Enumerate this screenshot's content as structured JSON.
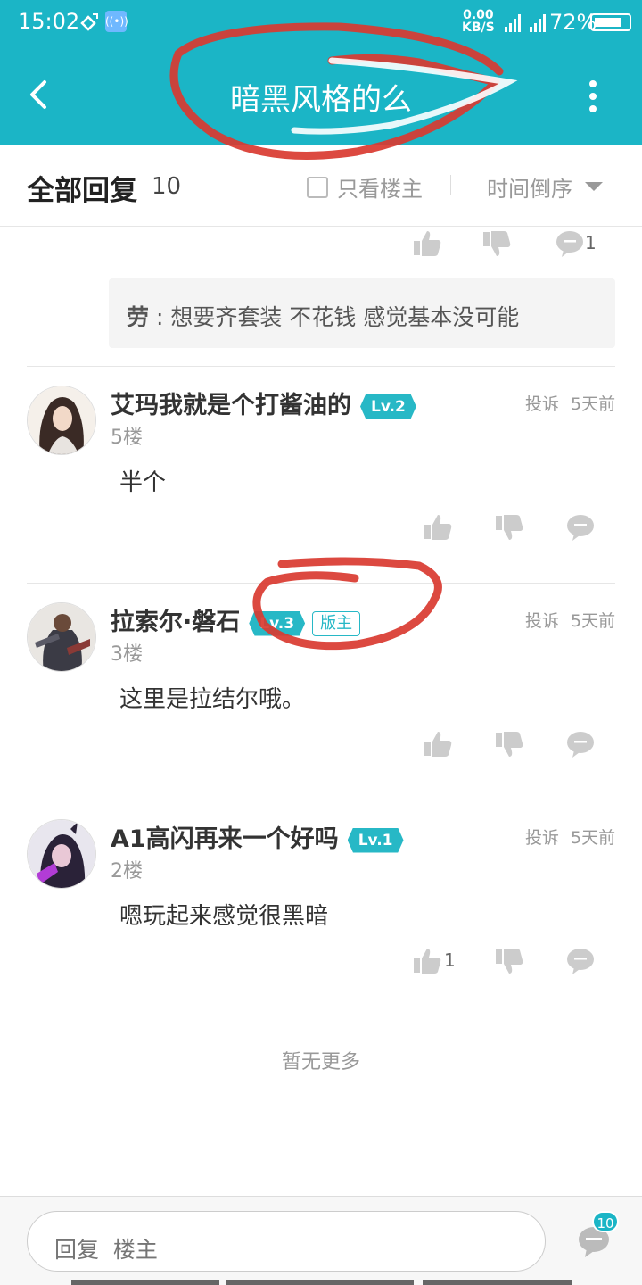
{
  "status": {
    "time": "15:02",
    "net_speed": "0.00",
    "net_unit": "KB/S",
    "battery": "72%"
  },
  "header": {
    "title": "暗黑风格的么"
  },
  "filter": {
    "all_replies": "全部回复",
    "count": "10",
    "only_op": "只看楼主",
    "sort": "时间倒序"
  },
  "top_actions": {
    "comment_count": "1"
  },
  "subreply": {
    "author": "劳",
    "separator": " : ",
    "text": "想要齐套装 不花钱 感觉基本没可能"
  },
  "posts": [
    {
      "user": "艾玛我就是个打酱油的",
      "level": "Lv.2",
      "floor": "5楼",
      "report": "投诉",
      "time": "5天前",
      "text": "半个"
    },
    {
      "user": "拉索尔·磐石",
      "level": "Lv.3",
      "moderator": "版主",
      "floor": "3楼",
      "report": "投诉",
      "time": "5天前",
      "text": "这里是拉结尔哦。"
    },
    {
      "user": "A1高闪再来一个好吗",
      "level": "Lv.1",
      "floor": "2楼",
      "report": "投诉",
      "time": "5天前",
      "text": "嗯玩起来感觉很黑暗",
      "like_count": "1"
    }
  ],
  "footer": {
    "no_more": "暂无更多"
  },
  "bottom": {
    "reply_placeholder": "回复  楼主",
    "comment_badge": "10"
  },
  "colors": {
    "accent": "#1bb5c6",
    "annotation": "#d93a30"
  },
  "icons": [
    "back-icon",
    "more-icon",
    "checkbox-icon",
    "caret-down-icon",
    "thumb-up-icon",
    "thumb-down-icon",
    "comment-icon"
  ]
}
